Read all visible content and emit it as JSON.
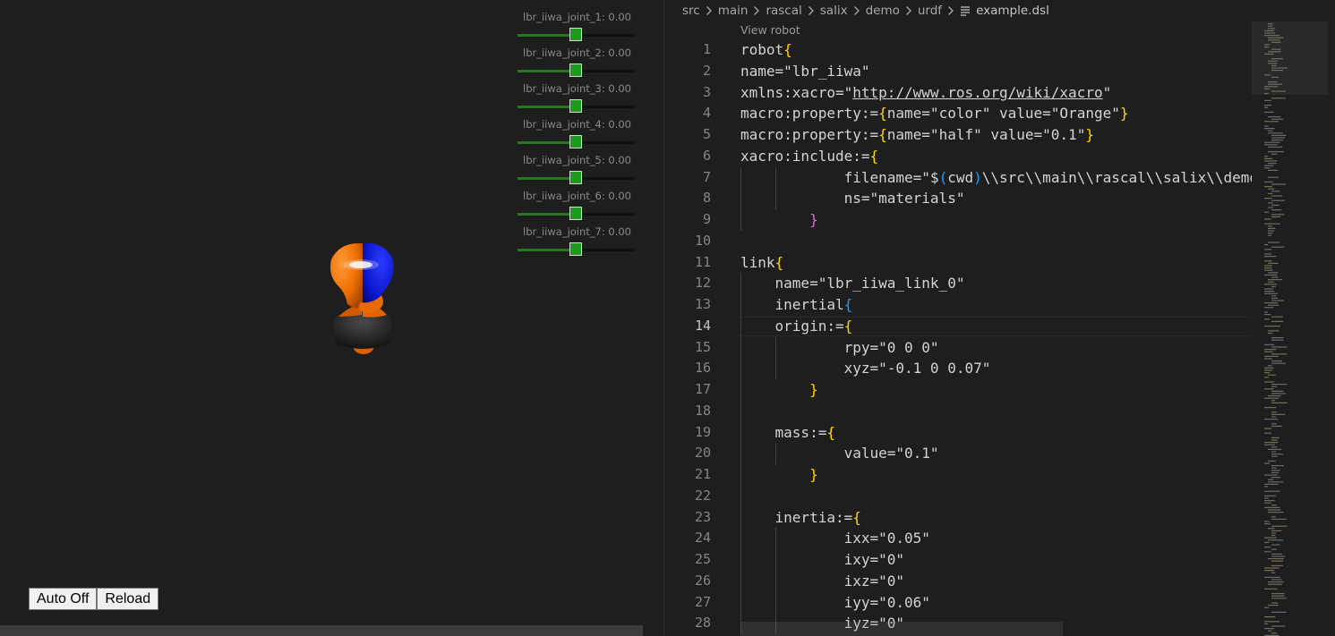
{
  "viewer": {
    "joints": [
      {
        "label": "lbr_iiwa_joint_1: 0.00",
        "value": 0.0,
        "position_fraction": 0.5
      },
      {
        "label": "lbr_iiwa_joint_2: 0.00",
        "value": 0.0,
        "position_fraction": 0.5
      },
      {
        "label": "lbr_iiwa_joint_3: 0.00",
        "value": 0.0,
        "position_fraction": 0.5
      },
      {
        "label": "lbr_iiwa_joint_4: 0.00",
        "value": 0.0,
        "position_fraction": 0.5
      },
      {
        "label": "lbr_iiwa_joint_5: 0.00",
        "value": 0.0,
        "position_fraction": 0.5
      },
      {
        "label": "lbr_iiwa_joint_6: 0.00",
        "value": 0.0,
        "position_fraction": 0.5
      },
      {
        "label": "lbr_iiwa_joint_7: 0.00",
        "value": 0.0,
        "position_fraction": 0.5
      }
    ],
    "buttons": {
      "auto": "Auto Off",
      "reload": "Reload"
    },
    "colors": {
      "slider_thumb": "#1e9b1e",
      "slider_fill": "#1f7a1f",
      "robot_orange": "#f06e00",
      "robot_blue": "#0a14c8"
    }
  },
  "editor": {
    "breadcrumb": [
      "src",
      "main",
      "rascal",
      "salix",
      "demo",
      "urdf"
    ],
    "file_name": "example.dsl",
    "codelens": "View robot",
    "active_line": 14,
    "lines": [
      {
        "n": "1",
        "text": "robot{"
      },
      {
        "n": "2",
        "text": "name=\"lbr_iiwa\""
      },
      {
        "n": "3",
        "text": "xmlns:xacro=\"http://www.ros.org/wiki/xacro\""
      },
      {
        "n": "4",
        "text": "macro:property:={name=\"color\" value=\"Orange\"}"
      },
      {
        "n": "5",
        "text": "macro:property:={name=\"half\" value=\"0.1\"}"
      },
      {
        "n": "6",
        "text": "xacro:include:={"
      },
      {
        "n": "7",
        "text": "            filename=\"$(cwd)\\\\src\\\\main\\\\rascal\\\\salix\\\\demo"
      },
      {
        "n": "8",
        "text": "            ns=\"materials\""
      },
      {
        "n": "9",
        "text": "        }"
      },
      {
        "n": "10",
        "text": ""
      },
      {
        "n": "11",
        "text": "link{"
      },
      {
        "n": "12",
        "text": "    name=\"lbr_iiwa_link_0\""
      },
      {
        "n": "13",
        "text": "    inertial{"
      },
      {
        "n": "14",
        "text": "    origin:={"
      },
      {
        "n": "15",
        "text": "            rpy=\"0 0 0\""
      },
      {
        "n": "16",
        "text": "            xyz=\"-0.1 0 0.07\""
      },
      {
        "n": "17",
        "text": "        }"
      },
      {
        "n": "18",
        "text": ""
      },
      {
        "n": "19",
        "text": "    mass:={"
      },
      {
        "n": "20",
        "text": "            value=\"0.1\""
      },
      {
        "n": "21",
        "text": "        }"
      },
      {
        "n": "22",
        "text": ""
      },
      {
        "n": "23",
        "text": "    inertia:={"
      },
      {
        "n": "24",
        "text": "            ixx=\"0.05\""
      },
      {
        "n": "25",
        "text": "            ixy=\"0\""
      },
      {
        "n": "26",
        "text": "            ixz=\"0\""
      },
      {
        "n": "27",
        "text": "            iyy=\"0.06\""
      },
      {
        "n": "28",
        "text": "            iyz=\"0\""
      }
    ]
  }
}
